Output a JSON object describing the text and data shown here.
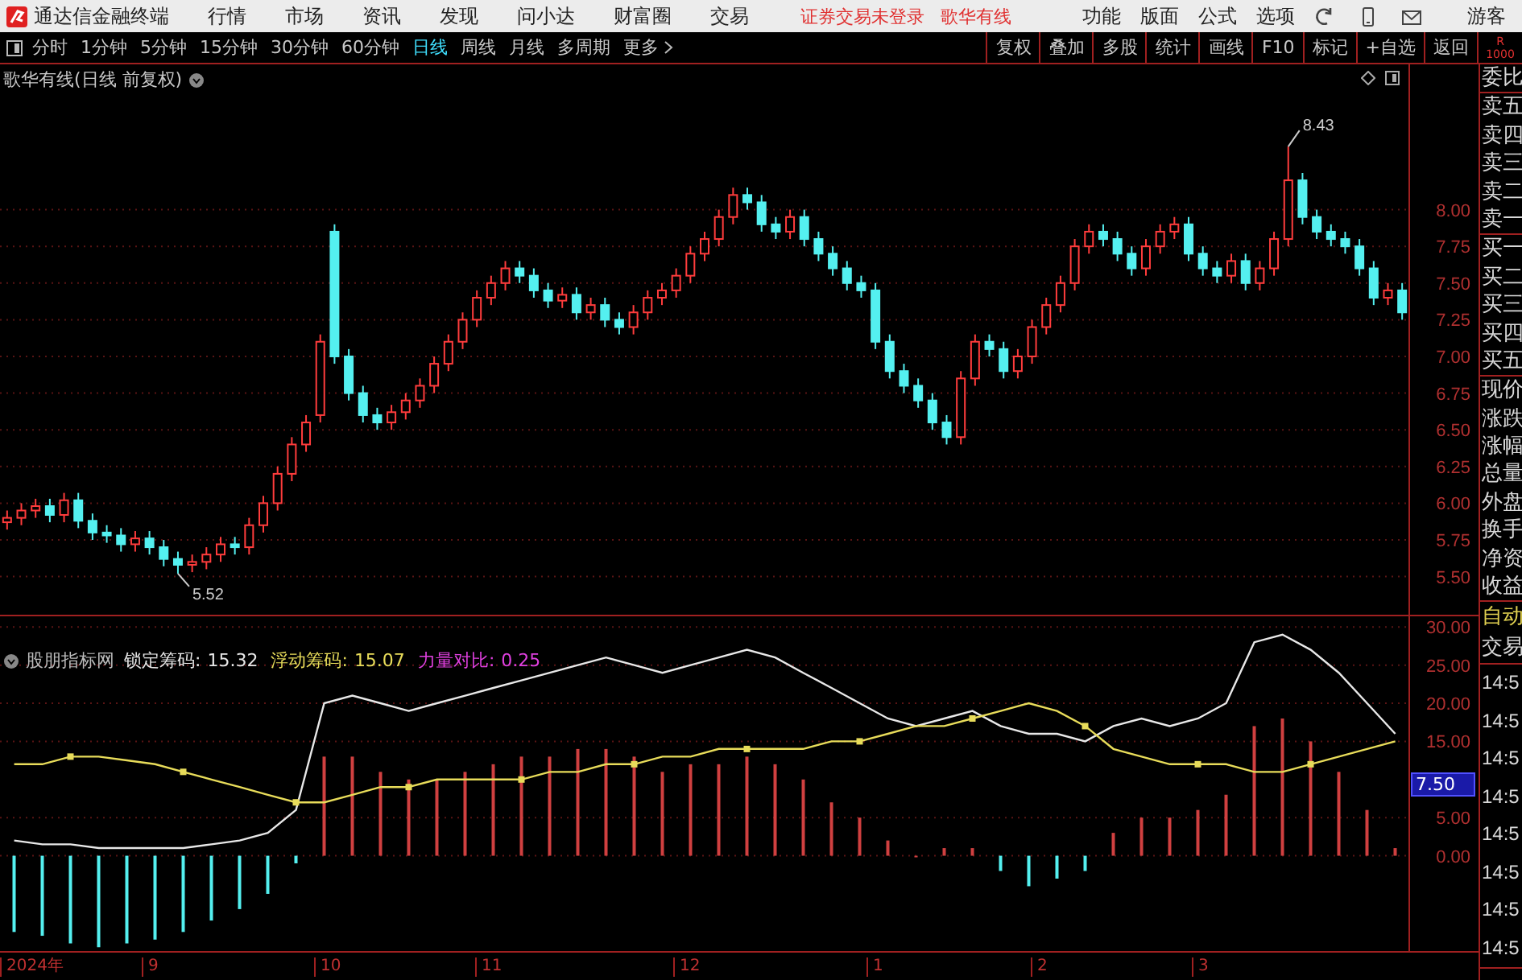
{
  "menu_bar": {
    "app_title": "通达信金融终端",
    "menus": [
      "行情",
      "市场",
      "资讯",
      "发现",
      "问小达",
      "财富圈",
      "交易"
    ],
    "notices": [
      "证券交易未登录",
      "歌华有线"
    ],
    "right_menus": [
      "功能",
      "版面",
      "公式",
      "选项"
    ],
    "user": "游客"
  },
  "toolbar": {
    "periods": [
      {
        "label": "分时",
        "selected": false
      },
      {
        "label": "1分钟",
        "selected": false
      },
      {
        "label": "5分钟",
        "selected": false
      },
      {
        "label": "15分钟",
        "selected": false
      },
      {
        "label": "30分钟",
        "selected": false
      },
      {
        "label": "60分钟",
        "selected": false
      },
      {
        "label": "日线",
        "selected": true
      },
      {
        "label": "周线",
        "selected": false
      },
      {
        "label": "月线",
        "selected": false
      },
      {
        "label": "多周期",
        "selected": false
      }
    ],
    "more": "更多",
    "buttons": [
      "复权",
      "叠加",
      "多股",
      "统计",
      "画线",
      "F10",
      "标记",
      "+自选",
      "返回"
    ],
    "badge": [
      "R",
      "1000"
    ]
  },
  "main_chart": {
    "title": "歌华有线(日线 前复权)",
    "chart_data": {
      "type": "candlestick",
      "grid": true,
      "ylim": [
        5.24,
        8.99
      ],
      "yticks": [
        {
          "value": 5.5,
          "label": "5.50"
        },
        {
          "value": 5.75,
          "label": "5.75"
        },
        {
          "value": 6.0,
          "label": "6.00"
        },
        {
          "value": 6.25,
          "label": "6.25"
        },
        {
          "value": 6.5,
          "label": "6.50"
        },
        {
          "value": 6.75,
          "label": "6.75"
        },
        {
          "value": 7.0,
          "label": "7.00"
        },
        {
          "value": 7.25,
          "label": "7.25"
        },
        {
          "value": 7.5,
          "label": "7.50"
        },
        {
          "value": 7.75,
          "label": "7.75"
        },
        {
          "value": 8.0,
          "label": "8.00"
        }
      ],
      "categories": [
        null,
        null,
        null,
        null,
        null,
        null,
        null,
        null,
        null,
        null,
        null,
        null,
        null,
        null,
        null,
        null,
        null,
        null,
        null,
        null,
        null,
        null,
        null,
        null,
        null,
        null,
        null,
        null,
        null,
        null,
        null,
        null,
        null,
        null,
        null,
        null,
        null,
        null,
        null,
        null,
        null,
        null,
        null,
        null,
        null,
        null,
        null,
        null,
        null,
        null,
        null,
        null,
        null,
        null,
        null,
        null,
        null,
        null,
        null,
        null,
        null,
        null,
        null,
        null,
        null,
        null,
        null,
        null,
        null,
        null,
        null,
        null,
        null,
        null,
        null,
        null,
        null,
        null,
        null,
        null,
        null,
        null,
        null,
        null,
        null,
        null,
        null,
        null,
        null,
        null,
        null,
        null,
        null,
        null,
        null,
        null,
        null,
        null,
        null
      ],
      "ohlc": [
        [
          5.87,
          5.95,
          5.82,
          5.9
        ],
        [
          5.9,
          6.0,
          5.85,
          5.95
        ],
        [
          5.95,
          6.03,
          5.9,
          5.98
        ],
        [
          5.98,
          6.03,
          5.87,
          5.92
        ],
        [
          5.92,
          6.07,
          5.87,
          6.02
        ],
        [
          6.02,
          6.07,
          5.83,
          5.88
        ],
        [
          5.88,
          5.93,
          5.75,
          5.8
        ],
        [
          5.8,
          5.85,
          5.73,
          5.78
        ],
        [
          5.78,
          5.83,
          5.67,
          5.72
        ],
        [
          5.72,
          5.81,
          5.67,
          5.76
        ],
        [
          5.76,
          5.81,
          5.65,
          5.7
        ],
        [
          5.7,
          5.75,
          5.57,
          5.62
        ],
        [
          5.62,
          5.67,
          5.52,
          5.58
        ],
        [
          5.58,
          5.65,
          5.53,
          5.6
        ],
        [
          5.6,
          5.7,
          5.55,
          5.65
        ],
        [
          5.65,
          5.77,
          5.6,
          5.72
        ],
        [
          5.72,
          5.77,
          5.65,
          5.7
        ],
        [
          5.7,
          5.9,
          5.65,
          5.85
        ],
        [
          5.85,
          6.05,
          5.8,
          6.0
        ],
        [
          6.0,
          6.25,
          5.95,
          6.2
        ],
        [
          6.2,
          6.45,
          6.15,
          6.4
        ],
        [
          6.4,
          6.6,
          6.35,
          6.55
        ],
        [
          6.6,
          7.15,
          6.55,
          7.1
        ],
        [
          7.85,
          7.9,
          6.95,
          7.0
        ],
        [
          7.0,
          7.05,
          6.7,
          6.75
        ],
        [
          6.75,
          6.8,
          6.55,
          6.6
        ],
        [
          6.6,
          6.65,
          6.5,
          6.55
        ],
        [
          6.55,
          6.67,
          6.5,
          6.62
        ],
        [
          6.62,
          6.75,
          6.57,
          6.7
        ],
        [
          6.7,
          6.85,
          6.65,
          6.8
        ],
        [
          6.8,
          7.0,
          6.75,
          6.95
        ],
        [
          6.95,
          7.15,
          6.9,
          7.1
        ],
        [
          7.1,
          7.3,
          7.05,
          7.25
        ],
        [
          7.25,
          7.45,
          7.2,
          7.4
        ],
        [
          7.4,
          7.55,
          7.35,
          7.5
        ],
        [
          7.5,
          7.65,
          7.45,
          7.6
        ],
        [
          7.6,
          7.65,
          7.5,
          7.55
        ],
        [
          7.55,
          7.6,
          7.4,
          7.45
        ],
        [
          7.45,
          7.5,
          7.33,
          7.38
        ],
        [
          7.38,
          7.47,
          7.33,
          7.42
        ],
        [
          7.42,
          7.47,
          7.25,
          7.3
        ],
        [
          7.3,
          7.4,
          7.25,
          7.35
        ],
        [
          7.35,
          7.4,
          7.2,
          7.25
        ],
        [
          7.25,
          7.3,
          7.15,
          7.2
        ],
        [
          7.2,
          7.35,
          7.15,
          7.3
        ],
        [
          7.3,
          7.45,
          7.25,
          7.4
        ],
        [
          7.4,
          7.5,
          7.35,
          7.45
        ],
        [
          7.45,
          7.6,
          7.4,
          7.55
        ],
        [
          7.55,
          7.75,
          7.5,
          7.7
        ],
        [
          7.7,
          7.85,
          7.65,
          7.8
        ],
        [
          7.8,
          8.0,
          7.75,
          7.95
        ],
        [
          7.95,
          8.15,
          7.9,
          8.1
        ],
        [
          8.1,
          8.15,
          8.0,
          8.05
        ],
        [
          8.05,
          8.1,
          7.85,
          7.9
        ],
        [
          7.9,
          7.95,
          7.8,
          7.85
        ],
        [
          7.85,
          8.0,
          7.8,
          7.95
        ],
        [
          7.95,
          8.0,
          7.75,
          7.8
        ],
        [
          7.8,
          7.85,
          7.65,
          7.7
        ],
        [
          7.7,
          7.75,
          7.55,
          7.6
        ],
        [
          7.6,
          7.65,
          7.45,
          7.5
        ],
        [
          7.5,
          7.55,
          7.4,
          7.45
        ],
        [
          7.45,
          7.5,
          7.05,
          7.1
        ],
        [
          7.1,
          7.15,
          6.85,
          6.9
        ],
        [
          6.9,
          6.95,
          6.75,
          6.8
        ],
        [
          6.8,
          6.85,
          6.65,
          6.7
        ],
        [
          6.7,
          6.75,
          6.5,
          6.55
        ],
        [
          6.55,
          6.6,
          6.4,
          6.45
        ],
        [
          6.45,
          6.9,
          6.4,
          6.85
        ],
        [
          6.85,
          7.15,
          6.8,
          7.1
        ],
        [
          7.1,
          7.15,
          7.0,
          7.05
        ],
        [
          7.05,
          7.1,
          6.85,
          6.9
        ],
        [
          6.9,
          7.05,
          6.85,
          7.0
        ],
        [
          7.0,
          7.25,
          6.95,
          7.2
        ],
        [
          7.2,
          7.4,
          7.15,
          7.35
        ],
        [
          7.35,
          7.55,
          7.3,
          7.5
        ],
        [
          7.5,
          7.8,
          7.45,
          7.75
        ],
        [
          7.75,
          7.9,
          7.7,
          7.85
        ],
        [
          7.85,
          7.9,
          7.75,
          7.8
        ],
        [
          7.8,
          7.85,
          7.65,
          7.7
        ],
        [
          7.7,
          7.75,
          7.55,
          7.6
        ],
        [
          7.6,
          7.8,
          7.55,
          7.75
        ],
        [
          7.75,
          7.9,
          7.7,
          7.85
        ],
        [
          7.85,
          7.95,
          7.8,
          7.9
        ],
        [
          7.9,
          7.95,
          7.65,
          7.7
        ],
        [
          7.7,
          7.75,
          7.55,
          7.6
        ],
        [
          7.6,
          7.65,
          7.5,
          7.55
        ],
        [
          7.55,
          7.7,
          7.5,
          7.65
        ],
        [
          7.65,
          7.7,
          7.45,
          7.5
        ],
        [
          7.5,
          7.65,
          7.45,
          7.6
        ],
        [
          7.6,
          7.85,
          7.55,
          7.8
        ],
        [
          7.8,
          8.43,
          7.75,
          8.2
        ],
        [
          8.2,
          8.25,
          7.9,
          7.95
        ],
        [
          7.95,
          8.0,
          7.8,
          7.85
        ],
        [
          7.85,
          7.9,
          7.75,
          7.8
        ],
        [
          7.8,
          7.85,
          7.7,
          7.75
        ],
        [
          7.75,
          7.8,
          7.55,
          7.6
        ],
        [
          7.6,
          7.65,
          7.35,
          7.4
        ],
        [
          7.4,
          7.5,
          7.35,
          7.45
        ],
        [
          7.45,
          7.5,
          7.25,
          7.3
        ]
      ],
      "annotations": [
        "8.43",
        "5.52"
      ]
    }
  },
  "date_axis": [
    "2024年",
    "9",
    "10",
    "11",
    "12",
    "1",
    "2",
    "3"
  ],
  "indicator": {
    "name": "股朋指标网",
    "legend": [
      {
        "value": "15.32",
        "color": "#e8e8e8"
      },
      {
        "value": "15.07",
        "color": "#e8dc5a"
      },
      {
        "value": "0.25",
        "color": "#e040e0"
      }
    ],
    "cursor_value": "7.50",
    "chart_data": {
      "type": "line",
      "grid": true,
      "ylim": [
        -12.5,
        31.4
      ],
      "yticks": [
        {
          "value": 0,
          "label": "0.00"
        },
        {
          "value": 5,
          "label": "5.00"
        },
        {
          "value": 15,
          "label": "15.00"
        },
        {
          "value": 20,
          "label": "20.00"
        },
        {
          "value": 25,
          "label": "25.00"
        },
        {
          "value": 30,
          "label": "30.00"
        }
      ],
      "series": [
        {
          "name": "锁定筹码:",
          "color": "#e8e8e8",
          "values": [
            2,
            1.5,
            1.5,
            1,
            1,
            1,
            1,
            1.5,
            2,
            3,
            6,
            20,
            21,
            20,
            19,
            20,
            21,
            22,
            23,
            24,
            25,
            26,
            25,
            24,
            25,
            26,
            27,
            26,
            24,
            22,
            20,
            18,
            17,
            18,
            19,
            17,
            16,
            16,
            15,
            17,
            18,
            17,
            18,
            20,
            28,
            29,
            27,
            24,
            20,
            16
          ]
        },
        {
          "name": "浮动筹码:",
          "color": "#e8dc5a",
          "values": [
            12,
            12,
            13,
            13,
            12.5,
            12,
            11,
            10,
            9,
            8,
            7,
            7,
            8,
            9,
            9,
            10,
            10,
            10,
            10,
            11,
            11,
            12,
            12,
            13,
            13,
            14,
            14,
            14,
            14,
            15,
            15,
            16,
            17,
            17,
            18,
            19,
            20,
            19,
            17,
            14,
            13,
            12,
            12,
            12,
            11,
            11,
            12,
            13,
            14,
            15
          ]
        },
        {
          "name": "力量对比:",
          "type": "bar",
          "color": "#d04040",
          "values": [
            null,
            null,
            null,
            null,
            null,
            null,
            null,
            null,
            null,
            null,
            null,
            13,
            13,
            11,
            10,
            10,
            11,
            12,
            13,
            13,
            14,
            14,
            13,
            11,
            12,
            12,
            13,
            12,
            10,
            7,
            5,
            2,
            0,
            1,
            1,
            null,
            null,
            null,
            null,
            3,
            5,
            5,
            6,
            8,
            17,
            18,
            15,
            11,
            6,
            1
          ]
        },
        {
          "type": "bar",
          "color": "#54f0f0",
          "values": [
            -10,
            -10.5,
            -11.5,
            -12,
            -11.5,
            -11,
            -10,
            -8.5,
            -7,
            -5,
            -1,
            null,
            null,
            null,
            null,
            null,
            null,
            null,
            null,
            null,
            null,
            null,
            null,
            null,
            null,
            null,
            null,
            null,
            null,
            null,
            null,
            null,
            null,
            null,
            null,
            -2,
            -4,
            -3,
            -2,
            null,
            null,
            null,
            null,
            null,
            null,
            null,
            null,
            null,
            null,
            null
          ]
        }
      ]
    }
  },
  "right_panel": {
    "groups": [
      {
        "items": [
          {
            "text": "委比",
            "highlight": false
          }
        ]
      },
      {
        "items": [
          {
            "text": "卖五",
            "highlight": false
          },
          {
            "text": "卖四",
            "highlight": false
          },
          {
            "text": "卖三",
            "highlight": false
          },
          {
            "text": "卖二",
            "highlight": false
          },
          {
            "text": "卖一",
            "highlight": false
          }
        ]
      },
      {
        "items": [
          {
            "text": "买一",
            "highlight": false
          },
          {
            "text": "买二",
            "highlight": false
          },
          {
            "text": "买三",
            "highlight": false
          },
          {
            "text": "买四",
            "highlight": false
          },
          {
            "text": "买五",
            "highlight": false
          }
        ]
      },
      {
        "items": [
          {
            "text": "现价",
            "highlight": false
          },
          {
            "text": "涨跌",
            "highlight": false
          },
          {
            "text": "涨幅",
            "highlight": false
          },
          {
            "text": "总量",
            "highlight": false
          },
          {
            "text": "外盘",
            "highlight": false
          },
          {
            "text": "换手",
            "highlight": false
          },
          {
            "text": "净资",
            "highlight": false
          },
          {
            "text": "收益",
            "highlight": false
          }
        ]
      },
      {
        "items": [
          {
            "text": "自动",
            "highlight": true
          },
          {
            "text": "交易",
            "highlight": false
          }
        ]
      },
      {
        "kind": "times",
        "items": [
          {
            "text": "14:5",
            "highlight": false
          },
          {
            "text": "14:5",
            "highlight": false
          },
          {
            "text": "14:5",
            "highlight": false
          },
          {
            "text": "14:5",
            "highlight": false
          },
          {
            "text": "14:5",
            "highlight": false
          },
          {
            "text": "14:5",
            "highlight": false
          },
          {
            "text": "14:5",
            "highlight": false
          },
          {
            "text": "14:5",
            "highlight": false
          }
        ]
      }
    ]
  }
}
